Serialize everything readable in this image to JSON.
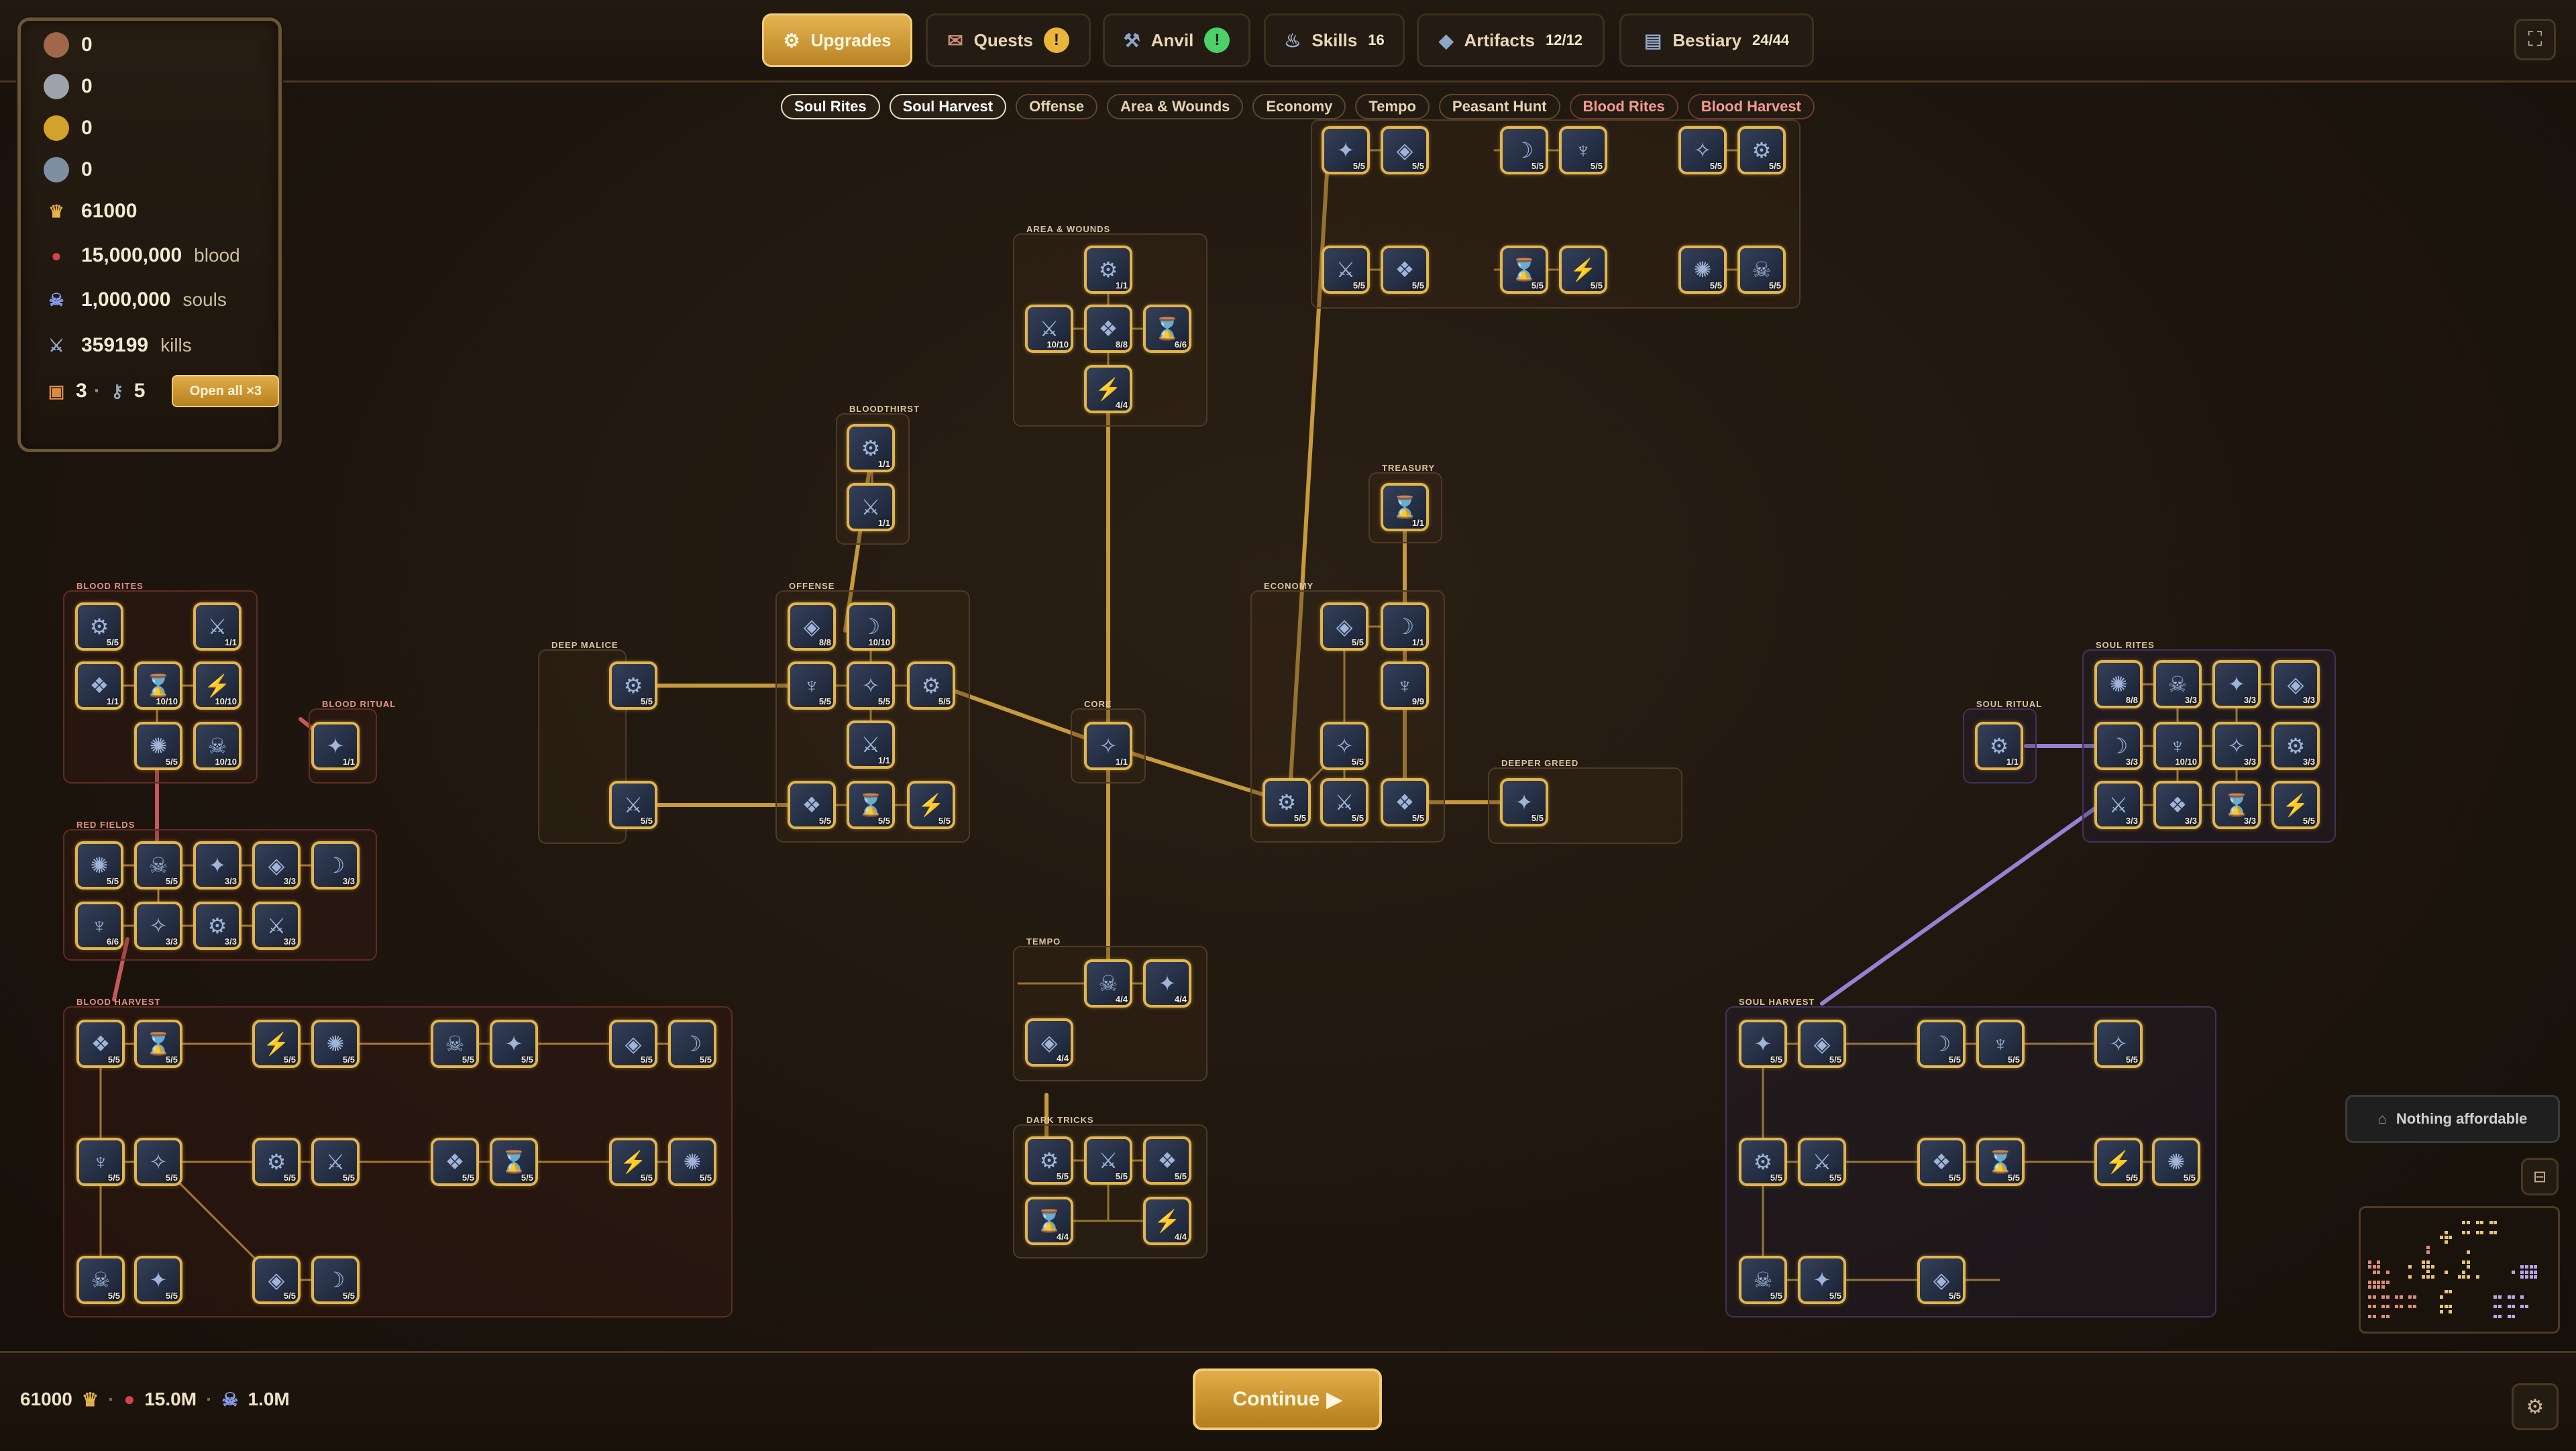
{
  "nav_tabs": [
    {
      "id": "upgrades",
      "label": "Upgrades",
      "icon": "gear-icon",
      "active": true
    },
    {
      "id": "quests",
      "label": "Quests",
      "icon": "scroll-icon",
      "badge": "!",
      "badge_color": "#e9b53a"
    },
    {
      "id": "anvil",
      "label": "Anvil",
      "icon": "anvil-icon",
      "badge": "!",
      "badge_color": "#4cd06a"
    },
    {
      "id": "skills",
      "label": "Skills",
      "icon": "flame-icon",
      "count": "16"
    },
    {
      "id": "artifacts",
      "label": "Artifacts",
      "icon": "artifact-icon",
      "count": "12/12"
    },
    {
      "id": "bestiary",
      "label": "Bestiary",
      "icon": "book-icon",
      "count": "24/44"
    }
  ],
  "resources": {
    "copper": "0",
    "silver": "0",
    "gold": "0",
    "gem": "0",
    "crowns": "61000",
    "blood": "15,000,000",
    "blood_unit": "blood",
    "souls": "1,000,000",
    "souls_unit": "souls",
    "kills": "359199",
    "kills_unit": "kills",
    "chests": "3",
    "chest_sep": "·",
    "keys": "5",
    "open_all_label": "Open all ×3"
  },
  "filters": [
    {
      "label": "Soul Rites",
      "state": "on"
    },
    {
      "label": "Soul Harvest",
      "state": "on"
    },
    {
      "label": "Offense",
      "state": "normal"
    },
    {
      "label": "Area & Wounds",
      "state": "normal"
    },
    {
      "label": "Economy",
      "state": "normal"
    },
    {
      "label": "Tempo",
      "state": "normal"
    },
    {
      "label": "Peasant Hunt",
      "state": "normal"
    },
    {
      "label": "Blood Rites",
      "state": "red"
    },
    {
      "label": "Blood Harvest",
      "state": "red"
    }
  ],
  "region_labels": {
    "area_wounds": "AREA & WOUNDS",
    "bloodthirst": "BLOODTHIRST",
    "treasury": "TREASURY",
    "offense": "OFFENSE",
    "economy": "ECONOMY",
    "deep_malice": "DEEP MALICE",
    "core": "CORE",
    "deeper_greed": "DEEPER GREED",
    "blood_rites": "BLOOD RITES",
    "blood_ritual": "BLOOD RITUAL",
    "red_fields": "RED FIELDS",
    "blood_harvest": "BLOOD HARVEST",
    "tempo": "TEMPO",
    "dark_tricks": "DARK TRICKS",
    "soul_ritual": "SOUL RITUAL",
    "soul_rites": "SOUL RITES",
    "soul_harvest": "SOUL HARVEST"
  },
  "nodes": {
    "peasant_hunt": [
      "5/5",
      "5/5",
      "5/5",
      "5/5",
      "5/5",
      "5/5",
      "5/5",
      "5/5",
      "5/5",
      "5/5",
      "5/5",
      "5/5"
    ],
    "area_wounds": [
      "1/1",
      "10/10",
      "8/8",
      "6/6",
      "4/4"
    ],
    "bloodthirst": [
      "1/1",
      "1/1"
    ],
    "treasury": [
      "1/1"
    ],
    "offense": [
      "8/8",
      "10/10",
      "5/5",
      "5/5",
      "5/5",
      "1/1",
      "5/5",
      "5/5",
      "5/5"
    ],
    "deep_malice": [
      "5/5",
      "5/5"
    ],
    "core": [
      "1/1"
    ],
    "economy": [
      "5/5",
      "1/1",
      "9/9",
      "5/5",
      "5/5",
      "5/5",
      "5/5"
    ],
    "deeper_greed": [
      "5/5"
    ],
    "blood_rites": [
      "5/5",
      "1/1",
      "1/1",
      "10/10",
      "10/10",
      "5/5",
      "10/10"
    ],
    "blood_ritual": [
      "1/1"
    ],
    "red_fields": [
      "5/5",
      "5/5",
      "3/3",
      "3/3",
      "3/3",
      "6/6",
      "3/3",
      "3/3",
      "3/3"
    ],
    "blood_harvest": [
      "5/5",
      "5/5",
      "5/5",
      "5/5",
      "5/5",
      "5/5",
      "5/5",
      "5/5",
      "5/5",
      "5/5",
      "5/5",
      "5/5",
      "5/5",
      "5/5",
      "5/5",
      "5/5",
      "5/5",
      "5/5",
      "5/5",
      "5/5"
    ],
    "tempo": [
      "4/4",
      "4/4",
      "4/4"
    ],
    "dark_tricks": [
      "5/5",
      "5/5",
      "5/5",
      "4/4",
      "4/4"
    ],
    "soul_ritual": [
      "1/1"
    ],
    "soul_rites": [
      "8/8",
      "3/3",
      "3/3",
      "3/3",
      "3/3",
      "10/10",
      "3/3",
      "3/3",
      "3/3",
      "3/3",
      "3/3",
      "5/5"
    ],
    "soul_harvest": [
      "5/5",
      "5/5",
      "5/5",
      "5/5",
      "5/5",
      "5/5",
      "5/5",
      "5/5",
      "5/5",
      "5/5",
      "5/5",
      "5/5",
      "5/5",
      "5/5"
    ]
  },
  "nothing_affordable": "Nothing affordable",
  "bottom": {
    "crowns": "61000",
    "blood": "15.0M",
    "souls": "1.0M",
    "sep": "·",
    "continue_label": "Continue"
  },
  "colors": {
    "accent_gold": "#e2b44c",
    "blood_line": "#c8575a",
    "soul_line": "#9b7fd6",
    "tree_line": "#c79a3c"
  }
}
